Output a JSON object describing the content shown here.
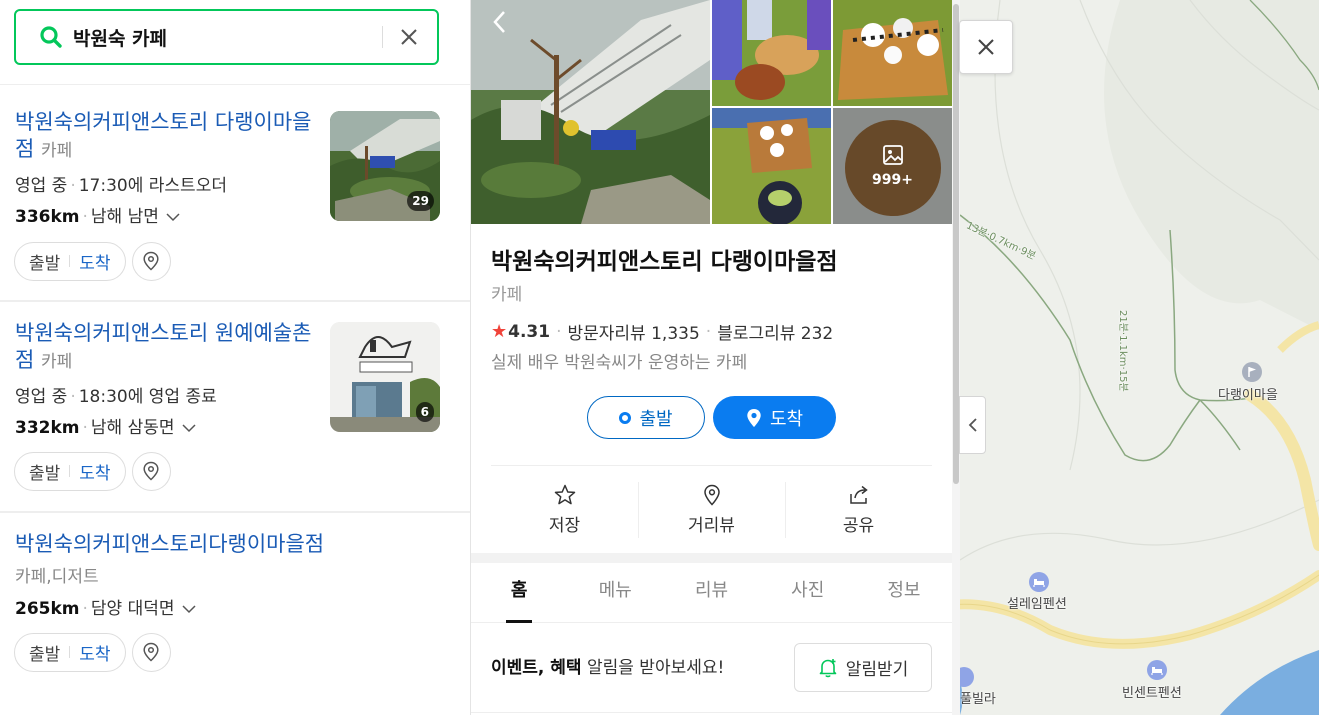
{
  "search": {
    "query": "박원숙 카페"
  },
  "results": [
    {
      "title": "박원숙의커피앤스토리 다랭이마을점",
      "category": "카페",
      "status_label": "영업 중",
      "status_detail": "17:30에 라스트오더",
      "distance": "336km",
      "address": "남해 남면",
      "photo_count": "29",
      "depart_label": "출발",
      "arrive_label": "도착"
    },
    {
      "title": "박원숙의커피앤스토리 원예예술촌점",
      "category": "카페",
      "status_label": "영업 중",
      "status_detail": "18:30에 영업 종료",
      "distance": "332km",
      "address": "남해 삼동면",
      "photo_count": "6",
      "depart_label": "출발",
      "arrive_label": "도착"
    },
    {
      "title": "박원숙의커피앤스토리다랭이마을점",
      "category": "카페,디저트",
      "distance": "265km",
      "address": "담양 대덕면",
      "depart_label": "출발",
      "arrive_label": "도착"
    }
  ],
  "detail": {
    "photo_more": "999+",
    "title": "박원숙의커피앤스토리 다랭이마을점",
    "category": "카페",
    "rating": "4.31",
    "visitor_reviews": "방문자리뷰 1,335",
    "blog_reviews": "블로그리뷰 232",
    "description": "실제 배우 박원숙씨가 운영하는 카페",
    "depart_label": "출발",
    "arrive_label": "도착",
    "actions": {
      "save": "저장",
      "street_view": "거리뷰",
      "share": "공유"
    },
    "tabs": [
      "홈",
      "메뉴",
      "리뷰",
      "사진",
      "정보"
    ],
    "event_bold": "이벤트, 혜택",
    "event_text": "알림을 받아보세요!",
    "notify_label": "알림받기"
  },
  "map": {
    "labels": {
      "village": "다랭이마을",
      "pension1": "설레임펜션",
      "pension2": "빈센트펜션",
      "villa": "풀빌라",
      "trail1": "13분·0.7km·9분",
      "trail2": "21분·1.1km·15분"
    }
  },
  "colors": {
    "accent_green": "#03c75a",
    "link_blue": "#1a5bb5",
    "action_blue": "#0a7cf0",
    "star_red": "#f0433a"
  }
}
